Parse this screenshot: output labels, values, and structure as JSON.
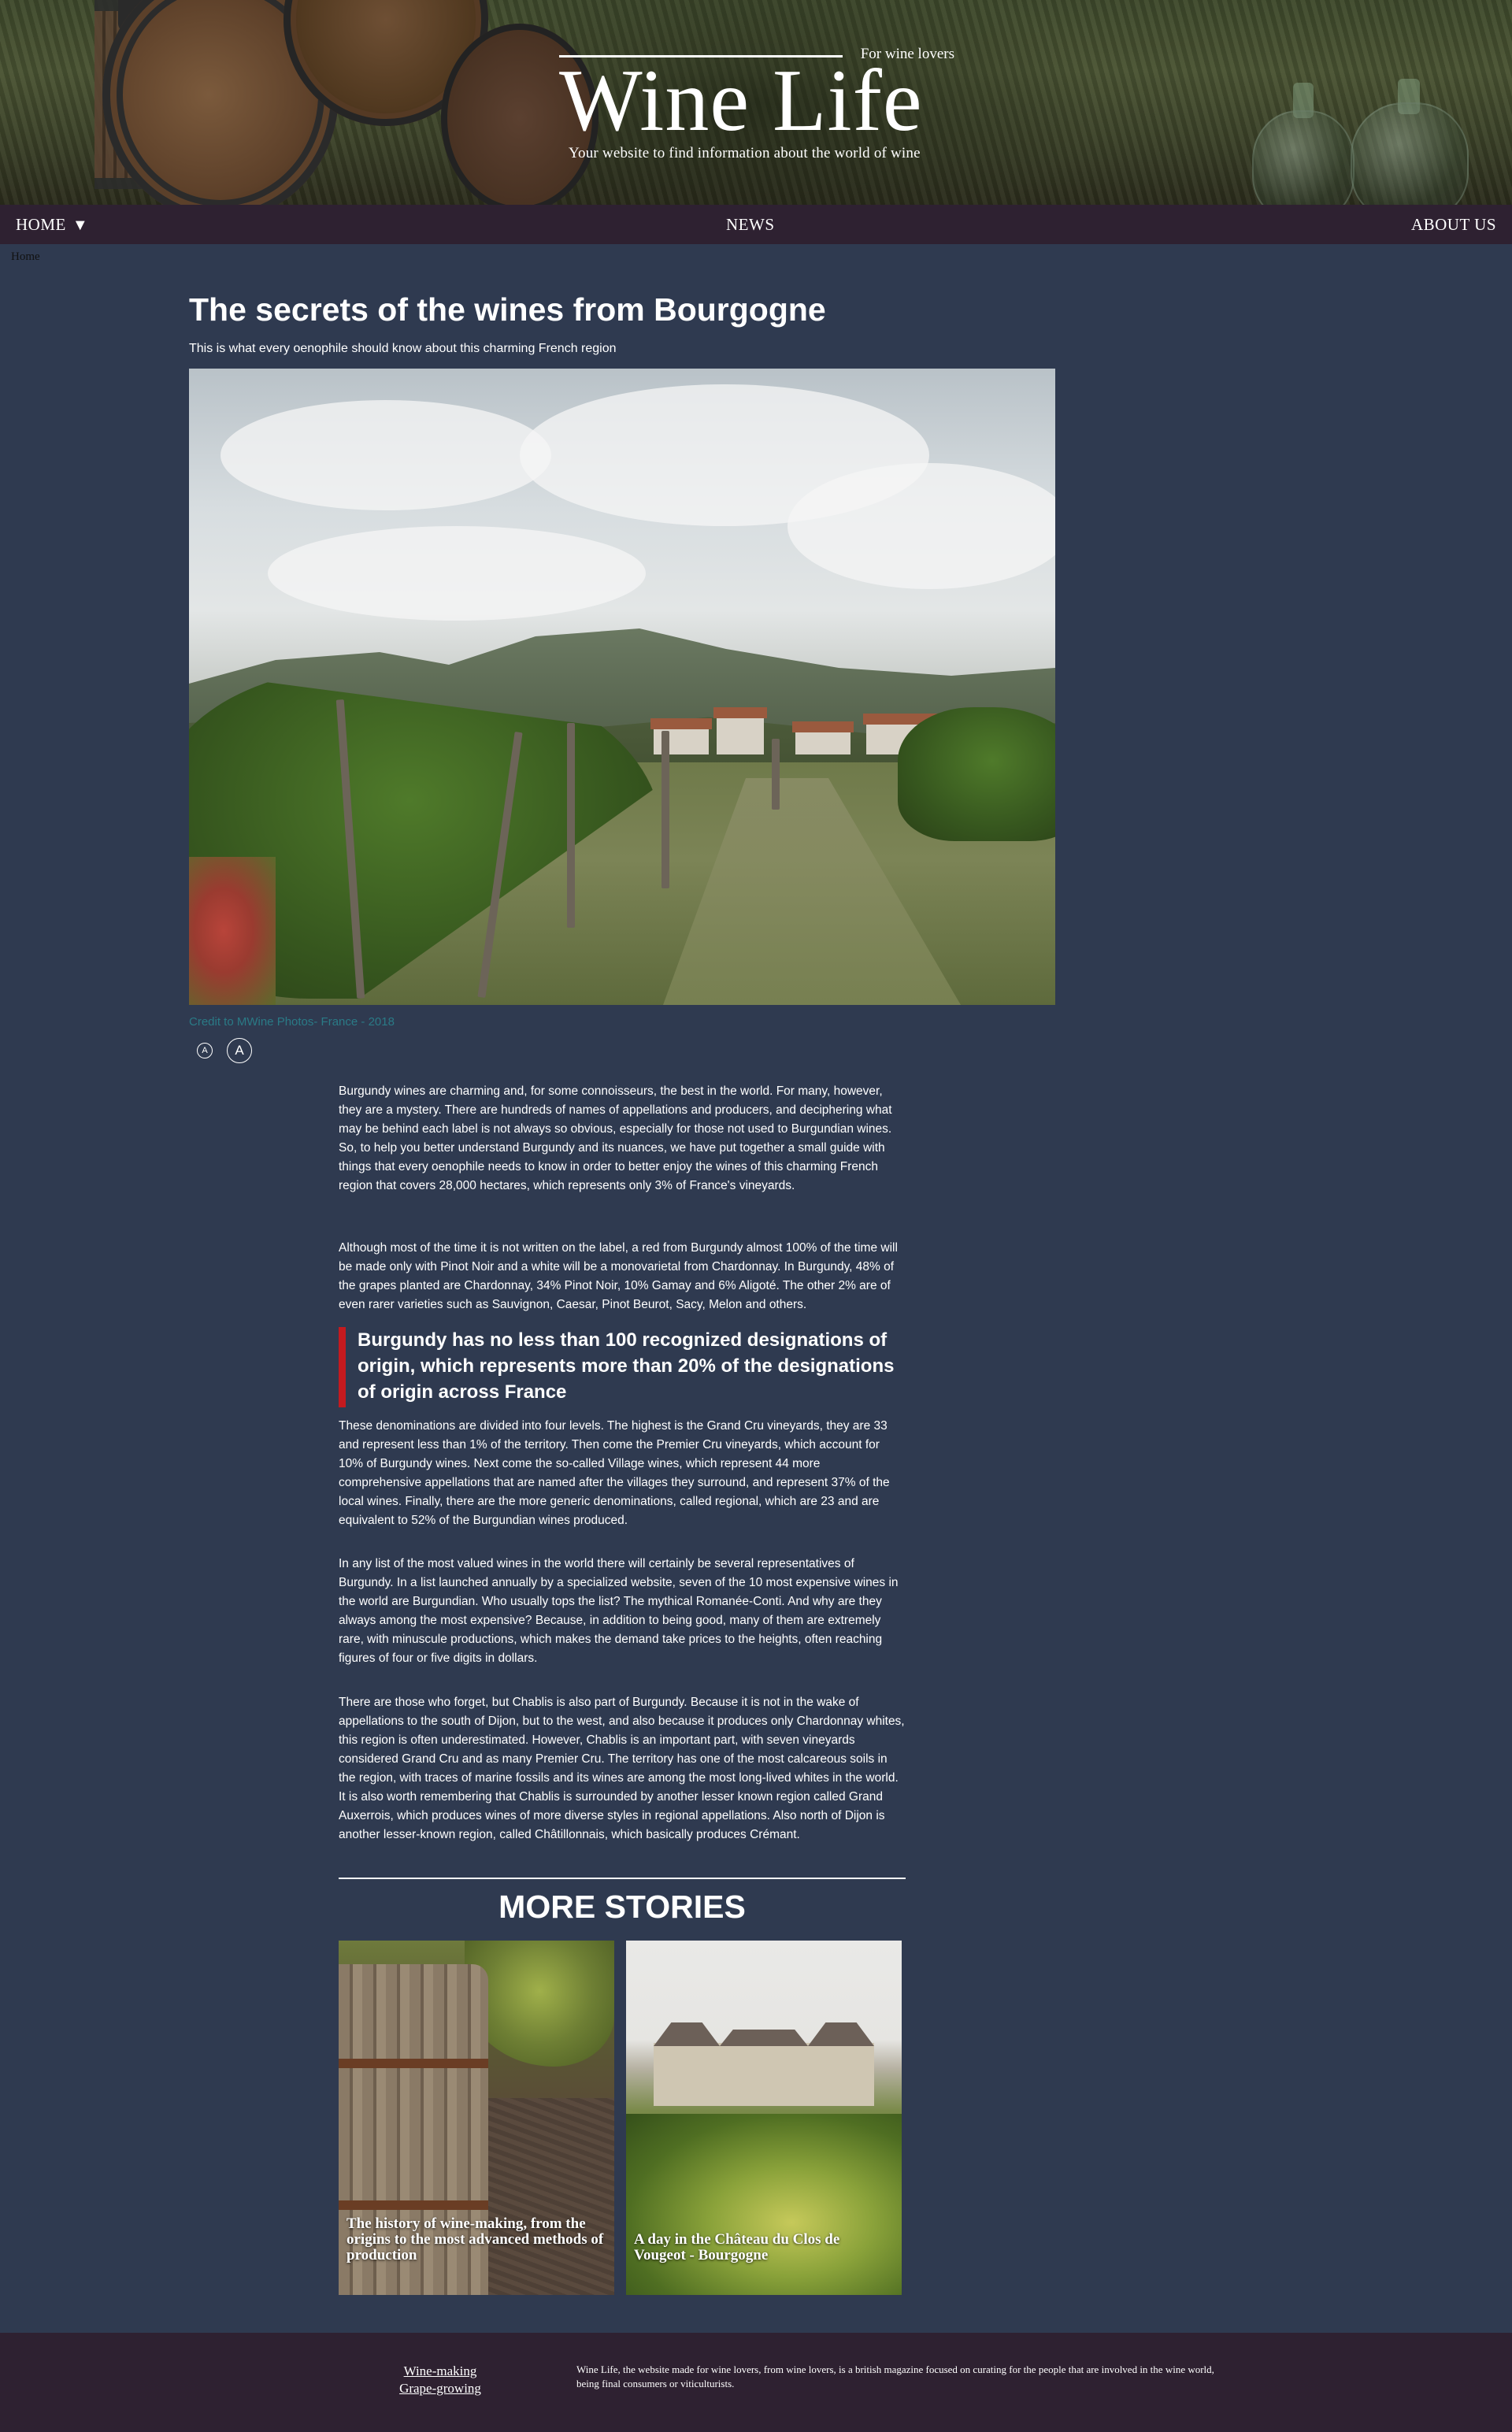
{
  "header": {
    "tagline": "For wine lovers",
    "title": "Wine Life",
    "subtitle": "Your website to find information about the world of wine"
  },
  "nav": {
    "home": "HOME",
    "news": "NEWS",
    "about": "ABOUT US",
    "caret_icon": "caret-down-icon"
  },
  "breadcrumb": "Home",
  "article": {
    "title": "The secrets of the wines from Bourgogne",
    "subtitle": "This is what every oenophile should know about this charming French region",
    "hero_caption": "Credit to MWine Photos- France - 2018",
    "font_small": "A",
    "font_large": "A",
    "paragraphs": [
      "Burgundy wines are charming and, for some connoisseurs, the best in the world. For many, however, they are a mystery. There are hundreds of names of appellations and producers, and deciphering what may be behind each label is not always so obvious, especially for those not used to Burgundian wines. So, to help you better understand Burgundy and its nuances, we have put together a small guide with things that every oenophile needs to know in order to better enjoy the wines of this charming French region that covers 28,000 hectares, which represents only 3% of France's vineyards.",
      "Although most of the time it is not written on the label, a red from Burgundy almost 100% of the time will be made only with Pinot Noir and a white will be a monovarietal from Chardonnay. In Burgundy, 48% of the grapes planted are Chardonnay, 34% Pinot Noir, 10% Gamay and 6% Aligoté. The other 2% are of even rarer varieties such as Sauvignon, Caesar, Pinot Beurot, Sacy, Melon and others.",
      "These denominations are divided into four levels. The highest is the Grand Cru vineyards, they are 33 and represent less than 1% of the territory. Then come the Premier Cru vineyards, which account for 10% of Burgundy wines. Next come the so-called Village wines, which represent 44 more comprehensive appellations that are named after the villages they surround, and represent 37% of the local wines. Finally, there are the more generic denominations, called regional, which are 23 and are equivalent to 52% of the Burgundian wines produced.",
      "In any list of the most valued wines in the world there will certainly be several representatives of Burgundy. In a list launched annually by a specialized website, seven of the 10 most expensive wines in the world are Burgundian. Who usually tops the list? The mythical Romanée-Conti. And why are they always among the most expensive? Because, in addition to being good, many of them are extremely rare, with minuscule productions, which makes the demand take prices to the heights, often reaching figures of four or five digits in dollars.",
      "There are those who forget, but Chablis is also part of Burgundy. Because it is not in the wake of appellations to the south of Dijon, but to the west, and also because it produces only Chardonnay whites, this region is often underestimated. However, Chablis is an important part, with seven vineyards considered Grand Cru and as many Premier Cru. The territory has one of the most calcareous soils in the region, with traces of marine fossils and its wines are among the most long-lived whites in the world. It is also worth remembering that Chablis is surrounded by another lesser known region called Grand Auxerrois, which produces wines of more diverse styles in regional appellations. Also north of Dijon is another lesser-known region, called Châtillonnais, which basically produces Crémant."
    ],
    "pull_quote": "Burgundy has no less than 100 recognized designations of origin, which represents more than 20% of the designations of origin across France",
    "accent_color": "#c41a1f",
    "caption_color": "#2a7a86"
  },
  "more_stories": {
    "heading": "MORE STORIES",
    "items": [
      {
        "title": "The history of wine-making, from the origins to the most advanced methods of production"
      },
      {
        "title": "A day in the Château du Clos de Vougeot - Bourgogne"
      }
    ]
  },
  "footer": {
    "links": [
      "Wine-making",
      "Grape-growing"
    ],
    "about": "Wine Life, the website made for wine lovers, from wine lovers, is a british magazine focused on curating for the people that are involved in the wine world, being final consumers or viticulturists."
  },
  "colors": {
    "page_bg": "#2f3a50",
    "nav_bg": "#2e2131",
    "footer_bg": "#2e2131"
  }
}
